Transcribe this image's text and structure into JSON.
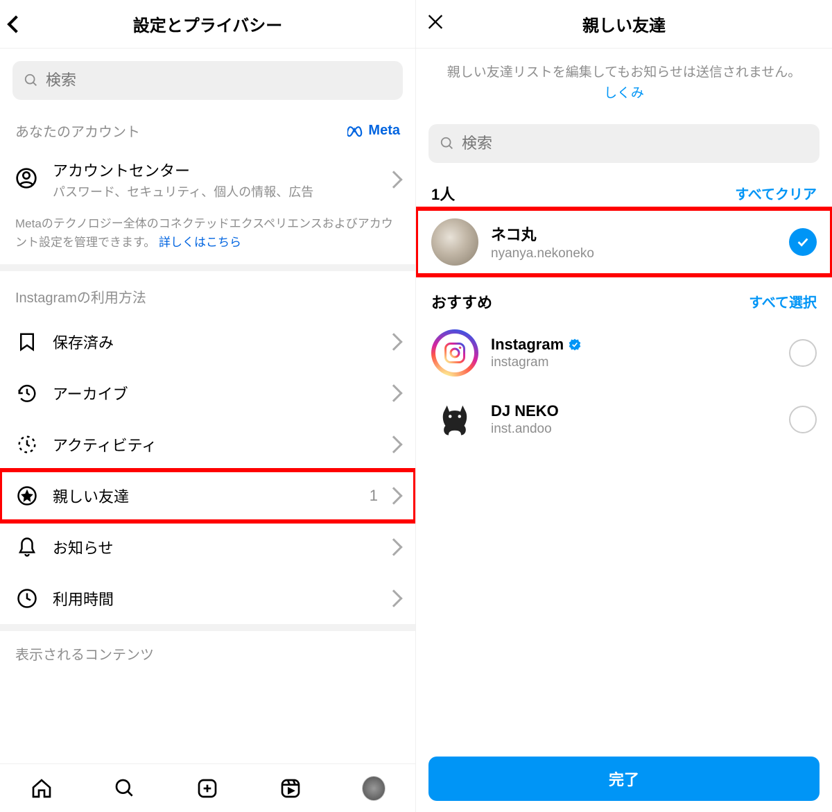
{
  "left": {
    "title": "設定とプライバシー",
    "search_placeholder": "検索",
    "account": {
      "section_label": "あなたのアカウント",
      "meta_label": "Meta",
      "center_title": "アカウントセンター",
      "center_subtitle": "パスワード、セキュリティ、個人の情報、広告",
      "meta_desc_1": "Metaのテクノロジー全体のコネクテッドエクスペリエンスおよびアカウント設定を管理できます。 ",
      "meta_desc_link": "詳しくはこちら"
    },
    "usage": {
      "section_label": "Instagramの利用方法",
      "items": [
        {
          "label": "保存済み",
          "count": ""
        },
        {
          "label": "アーカイブ",
          "count": ""
        },
        {
          "label": "アクティビティ",
          "count": ""
        },
        {
          "label": "親しい友達",
          "count": "1"
        },
        {
          "label": "お知らせ",
          "count": ""
        },
        {
          "label": "利用時間",
          "count": ""
        }
      ]
    },
    "display_section_label": "表示されるコンテンツ"
  },
  "right": {
    "title": "親しい友達",
    "info_text_1": "親しい友達リストを編集してもお知らせは送信されません。",
    "info_link": "しくみ",
    "search_placeholder": "検索",
    "count_label": "1人",
    "clear_all": "すべてクリア",
    "friends": [
      {
        "name": "ネコ丸",
        "handle": "nyanya.nekoneko",
        "checked": true
      }
    ],
    "recommend_label": "おすすめ",
    "select_all": "すべて選択",
    "recommendations": [
      {
        "name": "Instagram",
        "handle": "instagram",
        "verified": true,
        "checked": false
      },
      {
        "name": "DJ NEKO",
        "handle": "inst.andoo",
        "verified": false,
        "checked": false
      }
    ],
    "done": "完了"
  }
}
